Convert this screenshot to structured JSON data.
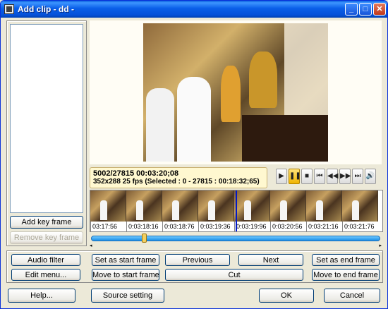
{
  "window": {
    "title": "Add clip - dd -"
  },
  "titlebar": {
    "minimize": "_",
    "maximize": "□",
    "close": "✕"
  },
  "left_panel": {
    "add_key_frame": "Add key frame",
    "remove_key_frame": "Remove key frame"
  },
  "info": {
    "line1": "5002/27815  00:03:20;08",
    "line2": "352x288 25 fps  (Selected : 0 - 27815 : 00:18:32;65)"
  },
  "transport": {
    "play": "▶",
    "pause": "❚❚",
    "stop": "■",
    "prev_frame": "⏮",
    "rewind": "◀◀",
    "forward": "▶▶",
    "next_frame": "⏭",
    "volume": "🔊"
  },
  "timeline": {
    "ticks": [
      "03:17:56",
      "0:03:18:16",
      "0:03:18:76",
      "0:03:19:36",
      "0:03:19:96",
      "0:03:20:56",
      "0:03:21:16",
      "0:03:21:76"
    ],
    "scroll_left": "◂",
    "scroll_right": "▸"
  },
  "actions": {
    "audio_filter": "Audio filter",
    "edit_menu": "Edit menu...",
    "set_start": "Set as start frame",
    "move_start": "Move to start frame",
    "previous": "Previous",
    "next": "Next",
    "cut": "Cut",
    "set_end": "Set as end frame",
    "move_end": "Move to end frame"
  },
  "footer": {
    "help": "Help...",
    "source_setting": "Source setting",
    "ok": "OK",
    "cancel": "Cancel"
  },
  "colors": {
    "titlebar": "#0a5fe8",
    "accent": "#0018c8",
    "info_bg": "#fff8d0"
  }
}
